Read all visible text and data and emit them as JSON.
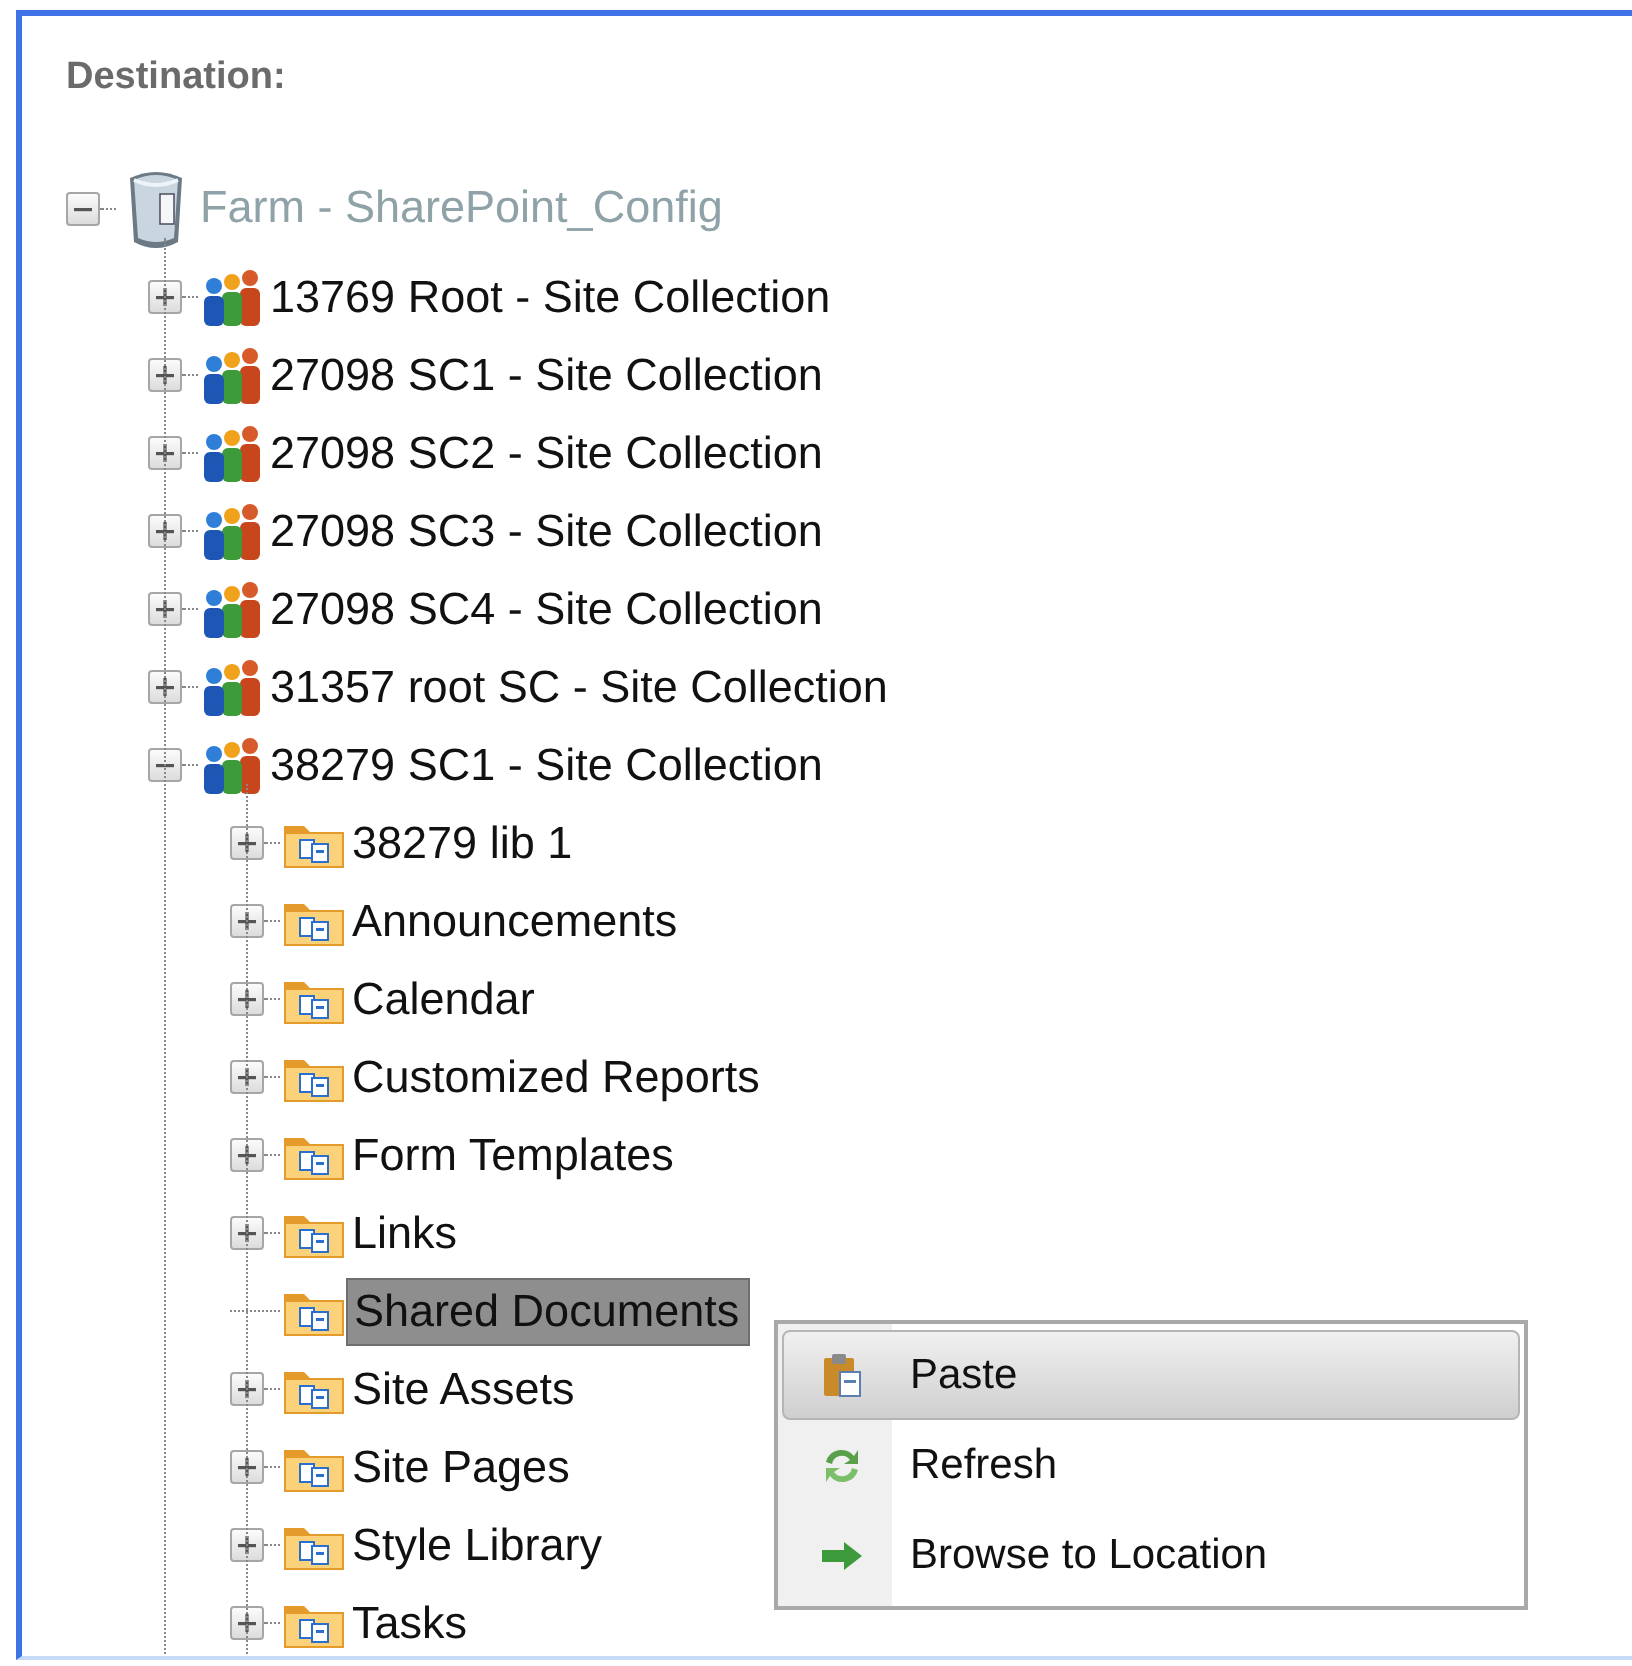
{
  "heading": "Destination:",
  "tree": [
    {
      "kind": "farm",
      "label": "Farm - SharePoint_Config",
      "expandable": true,
      "expanded": true,
      "dimmed": true,
      "selected": false,
      "children": [
        {
          "kind": "site-collection",
          "label": "13769 Root - Site Collection",
          "expandable": true,
          "expanded": false,
          "selected": false
        },
        {
          "kind": "site-collection",
          "label": "27098 SC1 - Site Collection",
          "expandable": true,
          "expanded": false,
          "selected": false
        },
        {
          "kind": "site-collection",
          "label": "27098 SC2 - Site Collection",
          "expandable": true,
          "expanded": false,
          "selected": false
        },
        {
          "kind": "site-collection",
          "label": "27098 SC3 - Site Collection",
          "expandable": true,
          "expanded": false,
          "selected": false
        },
        {
          "kind": "site-collection",
          "label": "27098 SC4 - Site Collection",
          "expandable": true,
          "expanded": false,
          "selected": false
        },
        {
          "kind": "site-collection",
          "label": "31357 root SC - Site Collection",
          "expandable": true,
          "expanded": false,
          "selected": false
        },
        {
          "kind": "site-collection",
          "label": "38279 SC1 - Site Collection",
          "expandable": true,
          "expanded": true,
          "selected": false,
          "children": [
            {
              "kind": "library",
              "label": "38279 lib 1",
              "expandable": true,
              "expanded": false,
              "selected": false
            },
            {
              "kind": "library",
              "label": "Announcements",
              "expandable": true,
              "expanded": false,
              "selected": false
            },
            {
              "kind": "library",
              "label": "Calendar",
              "expandable": true,
              "expanded": false,
              "selected": false
            },
            {
              "kind": "library",
              "label": "Customized Reports",
              "expandable": true,
              "expanded": false,
              "selected": false
            },
            {
              "kind": "library",
              "label": "Form Templates",
              "expandable": true,
              "expanded": false,
              "selected": false
            },
            {
              "kind": "library",
              "label": "Links",
              "expandable": true,
              "expanded": false,
              "selected": false
            },
            {
              "kind": "library",
              "label": "Shared Documents",
              "expandable": false,
              "selected": true
            },
            {
              "kind": "library",
              "label": "Site Assets",
              "expandable": true,
              "expanded": false,
              "selected": false
            },
            {
              "kind": "library",
              "label": "Site Pages",
              "expandable": true,
              "expanded": false,
              "selected": false
            },
            {
              "kind": "library",
              "label": "Style Library",
              "expandable": true,
              "expanded": false,
              "selected": false
            },
            {
              "kind": "library",
              "label": "Tasks",
              "expandable": true,
              "expanded": false,
              "selected": false
            }
          ]
        }
      ]
    }
  ],
  "context_menu": [
    {
      "kind": "paste",
      "label": "Paste",
      "selected": true
    },
    {
      "kind": "refresh",
      "label": "Refresh",
      "selected": false
    },
    {
      "kind": "browse",
      "label": "Browse to Location",
      "selected": false
    }
  ]
}
